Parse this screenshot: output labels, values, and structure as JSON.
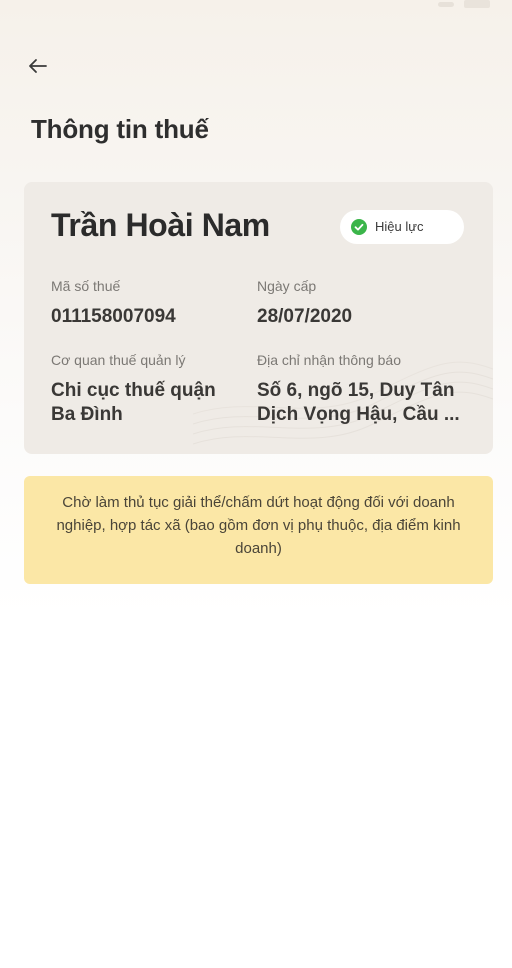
{
  "header": {
    "back_icon": "arrow-left-icon",
    "title": "Thông tin thuế"
  },
  "taxpayer": {
    "name": "Trần Hoài Nam",
    "status": {
      "label": "Hiệu lực",
      "icon": "check-circle-icon",
      "color": "#3bb54a"
    },
    "fields": {
      "tax_code": {
        "label": "Mã số thuế",
        "value": "011158007094"
      },
      "issue_date": {
        "label": "Ngày cấp",
        "value": "28/07/2020"
      },
      "tax_authority": {
        "label": "Cơ quan thuế quản lý",
        "value_line1": "Chi cục thuế quận",
        "value_line2": "Ba Đình"
      },
      "notice_address": {
        "label": "Địa chỉ nhận thông báo",
        "value_line1": "Số 6, ngõ 15, Duy Tân",
        "value_line2": "Dịch Vọng Hậu, Cầu ..."
      }
    }
  },
  "notice": {
    "text": "Chờ làm thủ tục giải thể/chấm dứt hoạt động đối với doanh nghiệp, hợp tác xã (bao gồm đơn vị phụ thuộc, địa điểm kinh doanh)",
    "background": "#fbe7a6"
  }
}
